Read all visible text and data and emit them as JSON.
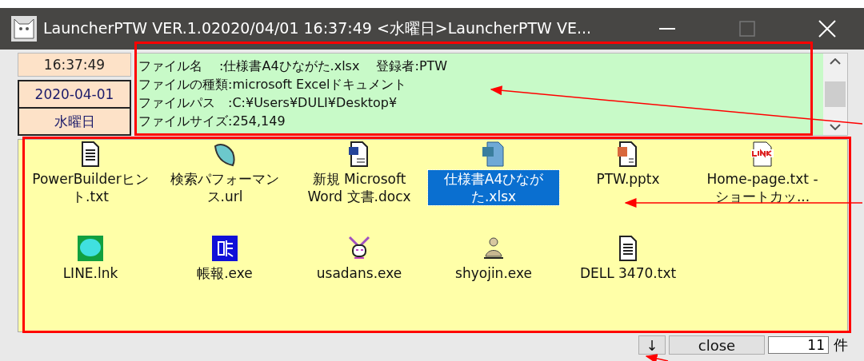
{
  "window": {
    "title": "LauncherPTW VER.1.02020/04/01 16:37:49 <水曜日>LauncherPTW VE..."
  },
  "clock": {
    "time": "16:37:49",
    "date": "2020-04-01",
    "weekday": "水曜日"
  },
  "info": {
    "lines": [
      "ファイル名　 :仕様書A4ひながた.xlsx　 登録者:PTW",
      "ファイルの種類:microsoft Excelドキュメント",
      "ファイルパス　:C:¥Users¥DULI¥Desktop¥",
      "ファイルサイズ:254,149"
    ]
  },
  "files": [
    {
      "label": "PowerBuilderヒント.txt",
      "selected": false
    },
    {
      "label": "検索パフォーマンス.url",
      "selected": false
    },
    {
      "label": "新規 Microsoft Word 文書.docx",
      "selected": false
    },
    {
      "label": "仕様書A4ひながた.xlsx",
      "selected": true
    },
    {
      "label": "PTW.pptx",
      "selected": false
    },
    {
      "label": "Home-page.txt - ショートカッ...",
      "selected": false
    },
    {
      "label": "LINE.lnk",
      "selected": false
    },
    {
      "label": "帳報.exe",
      "selected": false
    },
    {
      "label": "usadans.exe",
      "selected": false
    },
    {
      "label": "shyojin.exe",
      "selected": false
    },
    {
      "label": "DELL 3470.txt",
      "selected": false
    }
  ],
  "footer": {
    "down_button": "↓",
    "close_button": "close",
    "count": "11",
    "count_unit": "件"
  }
}
